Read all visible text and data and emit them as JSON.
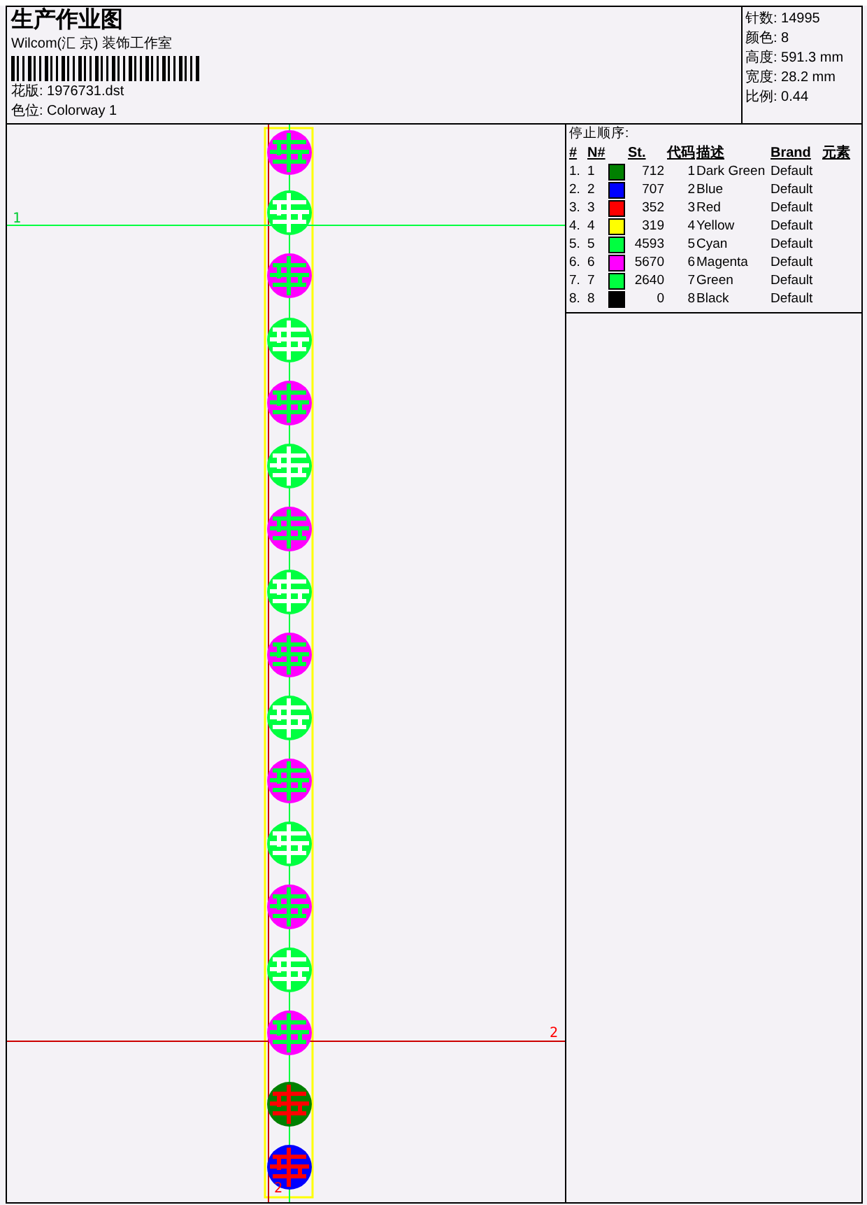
{
  "header": {
    "title": "生产作业图",
    "studio": "Wilcom(汇 京) 装饰工作室",
    "design_file": "花版: 1976731.dst",
    "colorway": "色位: Colorway 1"
  },
  "stats": [
    "针数: 14995",
    "颜色: 8",
    "高度: 591.3 mm",
    "宽度: 28.2 mm",
    "比例: 0.44"
  ],
  "canvas": {
    "markers": [
      {
        "kind": "start",
        "label": "1"
      },
      {
        "kind": "end",
        "label": "2"
      },
      {
        "kind": "end-bottom",
        "label": "2"
      }
    ],
    "medallions": [
      {
        "kind": "magenta"
      },
      {
        "kind": "green"
      },
      {
        "kind": "magenta"
      },
      {
        "kind": "green"
      },
      {
        "kind": "magenta"
      },
      {
        "kind": "green"
      },
      {
        "kind": "magenta"
      },
      {
        "kind": "green"
      },
      {
        "kind": "magenta"
      },
      {
        "kind": "green"
      },
      {
        "kind": "magenta"
      },
      {
        "kind": "green"
      },
      {
        "kind": "magenta"
      },
      {
        "kind": "green"
      },
      {
        "kind": "magenta"
      },
      {
        "kind": "red"
      },
      {
        "kind": "blue"
      }
    ]
  },
  "stop_sequence": {
    "title": "停止顺序:",
    "columns": [
      "#",
      "N#",
      "St.",
      "代码",
      "描述",
      "Brand",
      "元素"
    ],
    "rows": [
      {
        "index": "1.",
        "needle": "1",
        "color": "#008000",
        "stitches": "712",
        "code": "1",
        "description": "Dark Green",
        "brand": "Default"
      },
      {
        "index": "2.",
        "needle": "2",
        "color": "#0000ff",
        "stitches": "707",
        "code": "2",
        "description": "Blue",
        "brand": "Default"
      },
      {
        "index": "3.",
        "needle": "3",
        "color": "#ff0000",
        "stitches": "352",
        "code": "3",
        "description": "Red",
        "brand": "Default"
      },
      {
        "index": "4.",
        "needle": "4",
        "color": "#ffff00",
        "stitches": "319",
        "code": "4",
        "description": "Yellow",
        "brand": "Default"
      },
      {
        "index": "5.",
        "needle": "5",
        "color": "#00ff40",
        "stitches": "4593",
        "code": "5",
        "description": "Cyan",
        "brand": "Default"
      },
      {
        "index": "6.",
        "needle": "6",
        "color": "#ff00ff",
        "stitches": "5670",
        "code": "6",
        "description": "Magenta",
        "brand": "Default"
      },
      {
        "index": "7.",
        "needle": "7",
        "color": "#00ff40",
        "stitches": "2640",
        "code": "7",
        "description": "Green",
        "brand": "Default"
      },
      {
        "index": "8.",
        "needle": "8",
        "color": "#000000",
        "stitches": "0",
        "code": "8",
        "description": "Black",
        "brand": "Default"
      }
    ]
  }
}
